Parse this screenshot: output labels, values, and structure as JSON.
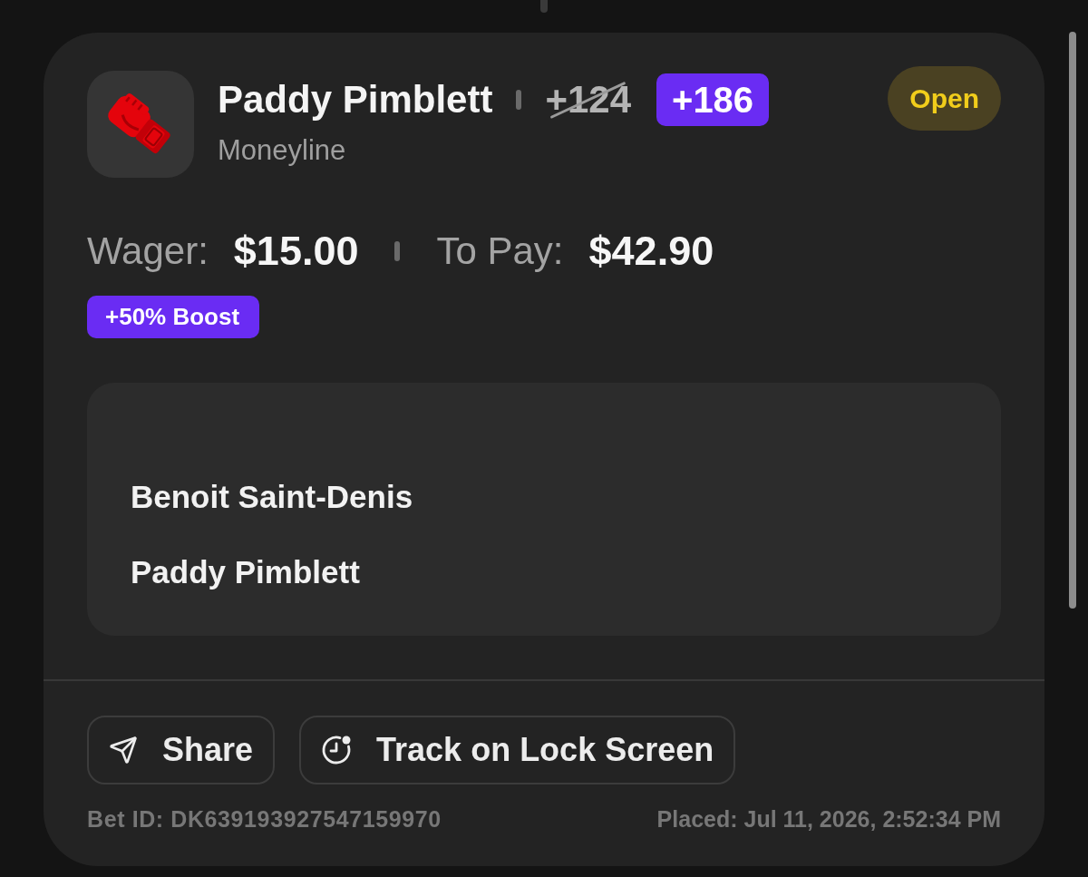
{
  "selection": {
    "title": "Paddy Pimblett",
    "market": "Moneyline",
    "original_odds": {
      "text": "+124",
      "struck": true
    },
    "boosted_odds": "+186",
    "status": "Open"
  },
  "amounts": [
    {
      "label": "Wager:",
      "value": "$15.00"
    },
    {
      "label": "To Pay:",
      "value": "$42.90"
    }
  ],
  "boost": "+50% Boost",
  "matchup": {
    "competitors": [
      "Benoit Saint-Denis",
      "Paddy Pimblett"
    ]
  },
  "actions": [
    {
      "kind": "share",
      "label": "Share"
    },
    {
      "kind": "track",
      "label": "Track on Lock Screen"
    }
  ],
  "footer": {
    "bet_id": "Bet ID: DK639193927547159970",
    "placed": "Placed: Jul 11, 2026, 2:52:34 PM"
  }
}
